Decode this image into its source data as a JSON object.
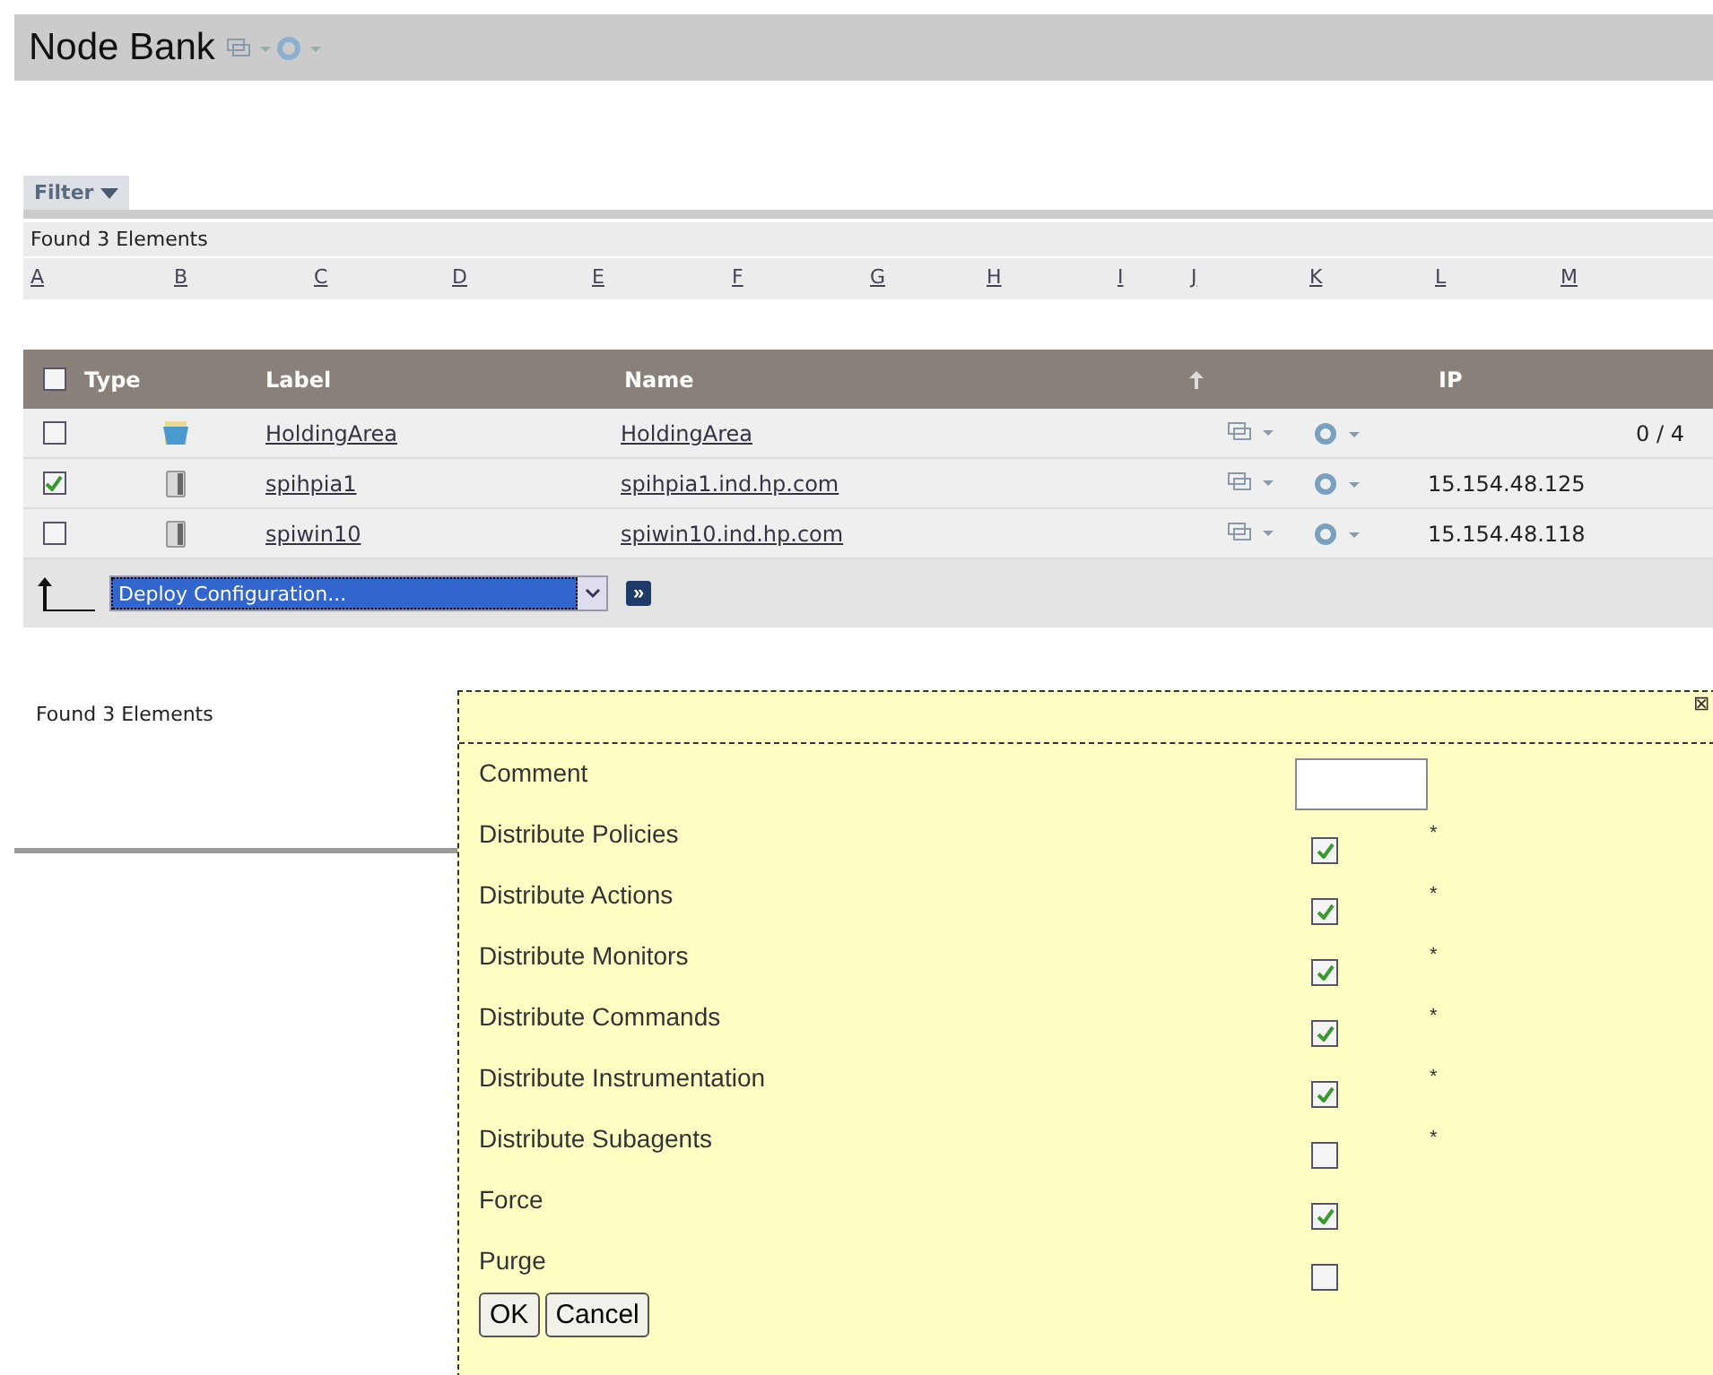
{
  "header": {
    "title": "Node Bank"
  },
  "filter": {
    "label": "Filter"
  },
  "found_top": "Found 3 Elements",
  "letters": [
    "A",
    "B",
    "C",
    "D",
    "E",
    "F",
    "G",
    "H",
    "I",
    "J",
    "K",
    "L",
    "M"
  ],
  "table": {
    "select_all": false,
    "columns": [
      "Type",
      "Label",
      "Name",
      "IP"
    ],
    "rows": [
      {
        "checked": false,
        "kind": "folder",
        "label": "HoldingArea",
        "name": "HoldingArea",
        "ip": "",
        "count": "0 / 4"
      },
      {
        "checked": true,
        "kind": "server",
        "label": "spihpia1",
        "name": "spihpia1.ind.hp.com",
        "ip": "15.154.48.125",
        "count": ""
      },
      {
        "checked": false,
        "kind": "server",
        "label": "spiwin10",
        "name": "spiwin10.ind.hp.com",
        "ip": "15.154.48.118",
        "count": ""
      }
    ]
  },
  "action": {
    "value": "Deploy Configuration...",
    "go": "»"
  },
  "found_bottom": "Found 3 Elements",
  "dialog": {
    "close": "⊠",
    "items": [
      {
        "kind": "text",
        "label": "Comment"
      },
      {
        "kind": "checkbox",
        "label": "Distribute Policies",
        "checked": true,
        "note": "*"
      },
      {
        "kind": "checkbox",
        "label": "Distribute Actions",
        "checked": true,
        "note": "*"
      },
      {
        "kind": "checkbox",
        "label": "Distribute Monitors",
        "checked": true,
        "note": "*"
      },
      {
        "kind": "checkbox",
        "label": "Distribute Commands",
        "checked": true,
        "note": "*"
      },
      {
        "kind": "checkbox",
        "label": "Distribute Instrumentation",
        "checked": true,
        "note": "*"
      },
      {
        "kind": "checkbox",
        "label": "Distribute Subagents",
        "checked": false,
        "note": "*"
      },
      {
        "kind": "checkbox",
        "label": "Force",
        "checked": true
      },
      {
        "kind": "checkbox",
        "label": "Purge",
        "checked": false
      }
    ],
    "buttons": [
      "OK",
      "Cancel"
    ]
  }
}
